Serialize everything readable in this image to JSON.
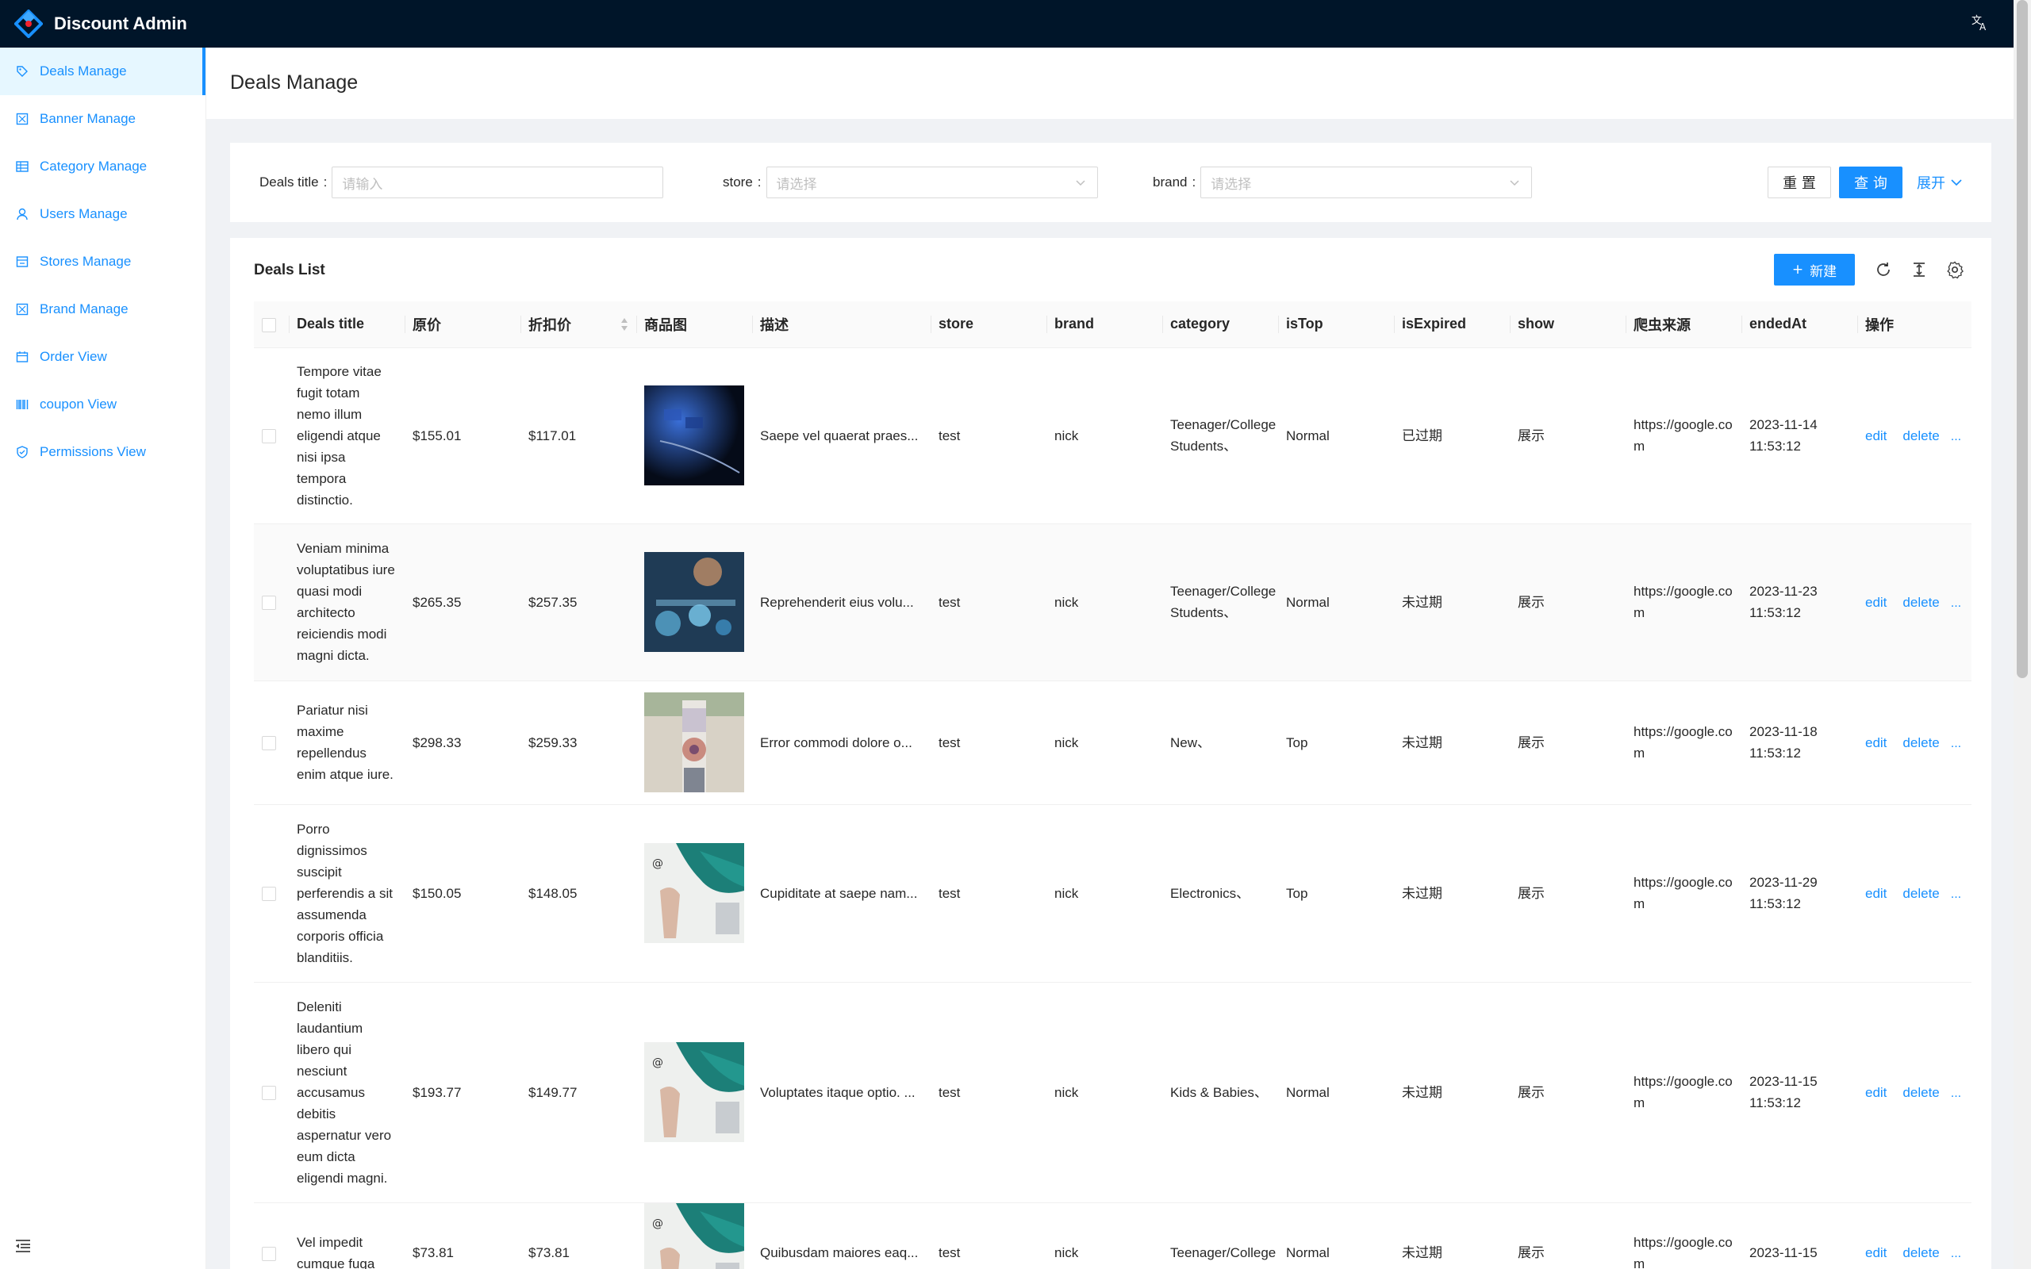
{
  "app": {
    "title": "Discount Admin"
  },
  "colors": {
    "header_bg": "#001529",
    "primary": "#1890ff",
    "page_bg": "#f0f2f5"
  },
  "sidebar": {
    "items": [
      {
        "label": "Deals Manage",
        "icon": "tag-icon",
        "active": true
      },
      {
        "label": "Banner Manage",
        "icon": "image-icon"
      },
      {
        "label": "Category Manage",
        "icon": "table-icon"
      },
      {
        "label": "Users Manage",
        "icon": "user-icon"
      },
      {
        "label": "Stores Manage",
        "icon": "shop-icon"
      },
      {
        "label": "Brand Manage",
        "icon": "image-icon"
      },
      {
        "label": "Order View",
        "icon": "calendar-icon"
      },
      {
        "label": "coupon View",
        "icon": "barcode-icon"
      },
      {
        "label": "Permissions View",
        "icon": "safety-icon"
      }
    ]
  },
  "page": {
    "title": "Deals Manage"
  },
  "search": {
    "deals_title_label": "Deals title",
    "deals_title_placeholder": "请输入",
    "store_label": "store",
    "store_placeholder": "请选择",
    "brand_label": "brand",
    "brand_placeholder": "请选择",
    "reset_label": "重 置",
    "query_label": "查 询",
    "expand_label": "展开"
  },
  "table": {
    "title": "Deals List",
    "new_label": "新建",
    "columns": [
      "Deals title",
      "原价",
      "折扣价",
      "商品图",
      "描述",
      "store",
      "brand",
      "category",
      "isTop",
      "isExpired",
      "show",
      "爬虫来源",
      "endedAt",
      "操作"
    ],
    "rows": [
      {
        "title": "Tempore vitae fugit totam nemo illum eligendi atque nisi ipsa tempora distinctio.",
        "price": "$155.01",
        "discount": "$117.01",
        "image": "keyboard-blue",
        "desc": "Saepe vel quaerat praes...",
        "store": "test",
        "brand": "nick",
        "category": "Teenager/College Students、",
        "isTop": "Normal",
        "isExpired": "已过期",
        "show": "展示",
        "source": "https://google.com",
        "endedAt": "2023-11-14 11:53:12",
        "edit": "edit",
        "delete": "delete",
        "more": "..."
      },
      {
        "title": "Veniam minima voluptatibus iure quasi modi architecto reiciendis modi magni dicta.",
        "price": "$265.35",
        "discount": "$257.35",
        "image": "keyboard-bokeh",
        "desc": "Reprehenderit eius volu...",
        "store": "test",
        "brand": "nick",
        "category": "Teenager/College Students、",
        "isTop": "Normal",
        "isExpired": "未过期",
        "show": "展示",
        "source": "https://google.com",
        "endedAt": "2023-11-23 11:53:12",
        "edit": "edit",
        "delete": "delete",
        "more": "..."
      },
      {
        "title": "Pariatur nisi maxime repellendus enim atque iure.",
        "price": "$298.33",
        "discount": "$259.33",
        "image": "person-bag",
        "desc": "Error commodi dolore o...",
        "store": "test",
        "brand": "nick",
        "category": "New、",
        "isTop": "Top",
        "isExpired": "未过期",
        "show": "展示",
        "source": "https://google.com",
        "endedAt": "2023-11-18 11:53:12",
        "edit": "edit",
        "delete": "delete",
        "more": "..."
      },
      {
        "title": "Porro dignissimos suscipit perferendis a sit assumenda corporis officia blanditiis.",
        "price": "$150.05",
        "discount": "$148.05",
        "image": "teal-fabric",
        "desc": "Cupiditate at saepe nam...",
        "store": "test",
        "brand": "nick",
        "category": "Electronics、",
        "isTop": "Top",
        "isExpired": "未过期",
        "show": "展示",
        "source": "https://google.com",
        "endedAt": "2023-11-29 11:53:12",
        "edit": "edit",
        "delete": "delete",
        "more": "..."
      },
      {
        "title": "Deleniti laudantium libero qui nesciunt accusamus debitis aspernatur vero eum dicta eligendi magni.",
        "price": "$193.77",
        "discount": "$149.77",
        "image": "teal-fabric",
        "desc": "Voluptates itaque optio. ...",
        "store": "test",
        "brand": "nick",
        "category": "Kids & Babies、",
        "isTop": "Normal",
        "isExpired": "未过期",
        "show": "展示",
        "source": "https://google.com",
        "endedAt": "2023-11-15 11:53:12",
        "edit": "edit",
        "delete": "delete",
        "more": "..."
      },
      {
        "title": "Vel impedit cumque fuga",
        "price": "$73.81",
        "discount": "$73.81",
        "image": "teal-fabric",
        "desc": "Quibusdam maiores eaq...",
        "store": "test",
        "brand": "nick",
        "category": "Teenager/College",
        "isTop": "Normal",
        "isExpired": "未过期",
        "show": "展示",
        "source": "https://google.com",
        "endedAt": "2023-11-15",
        "edit": "edit",
        "delete": "delete",
        "more": "..."
      }
    ]
  }
}
